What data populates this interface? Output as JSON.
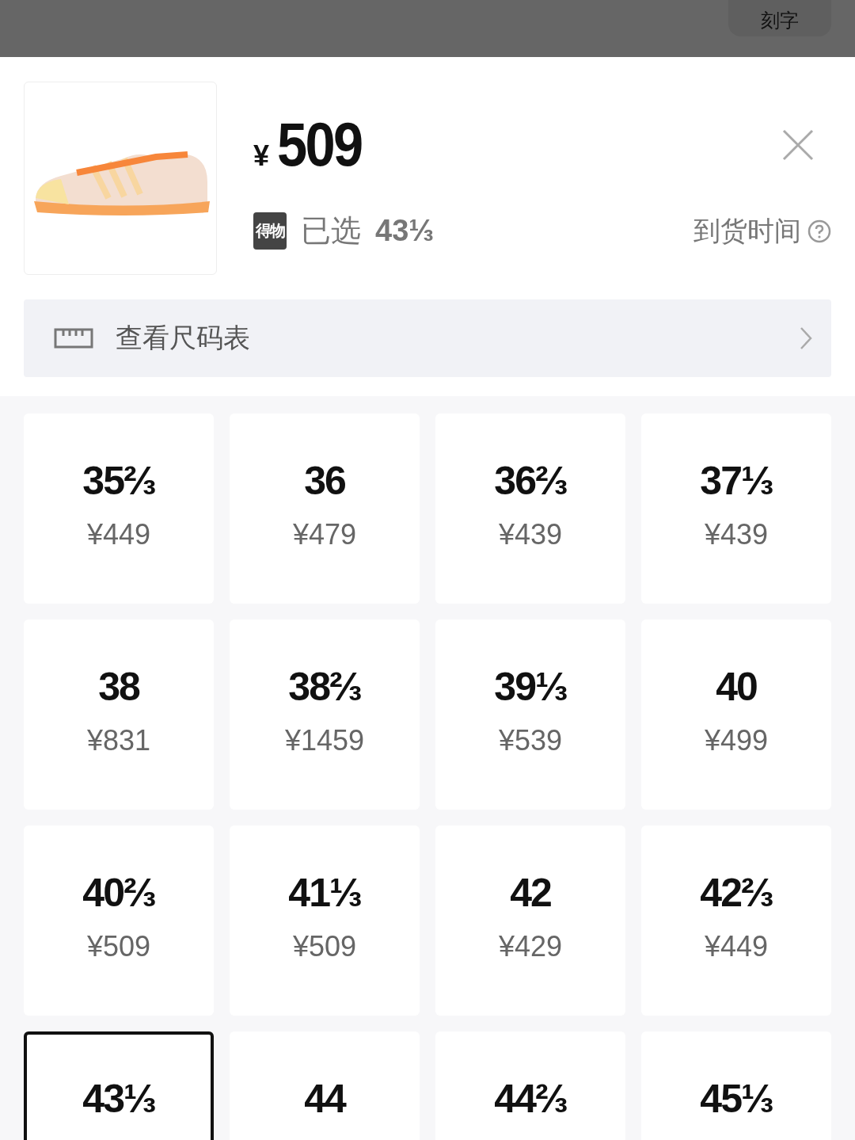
{
  "backdrop": {
    "button": "刻字"
  },
  "product": {
    "currency": "¥",
    "price": "509",
    "brand_badge": "得物",
    "selected_label": "已选",
    "selected_size": "43⅓",
    "arrival_time": "到货时间"
  },
  "size_chart": {
    "label": "查看尺码表"
  },
  "sizes": [
    {
      "size": "35⅔",
      "price": "¥449",
      "selected": false
    },
    {
      "size": "36",
      "price": "¥479",
      "selected": false
    },
    {
      "size": "36⅔",
      "price": "¥439",
      "selected": false
    },
    {
      "size": "37⅓",
      "price": "¥439",
      "selected": false
    },
    {
      "size": "38",
      "price": "¥831",
      "selected": false
    },
    {
      "size": "38⅔",
      "price": "¥1459",
      "selected": false
    },
    {
      "size": "39⅓",
      "price": "¥539",
      "selected": false
    },
    {
      "size": "40",
      "price": "¥499",
      "selected": false
    },
    {
      "size": "40⅔",
      "price": "¥509",
      "selected": false
    },
    {
      "size": "41⅓",
      "price": "¥509",
      "selected": false
    },
    {
      "size": "42",
      "price": "¥429",
      "selected": false
    },
    {
      "size": "42⅔",
      "price": "¥449",
      "selected": false
    },
    {
      "size": "43⅓",
      "selected": true
    },
    {
      "size": "44",
      "selected": false
    },
    {
      "size": "44⅔",
      "selected": false
    },
    {
      "size": "45⅓",
      "selected": false
    }
  ]
}
